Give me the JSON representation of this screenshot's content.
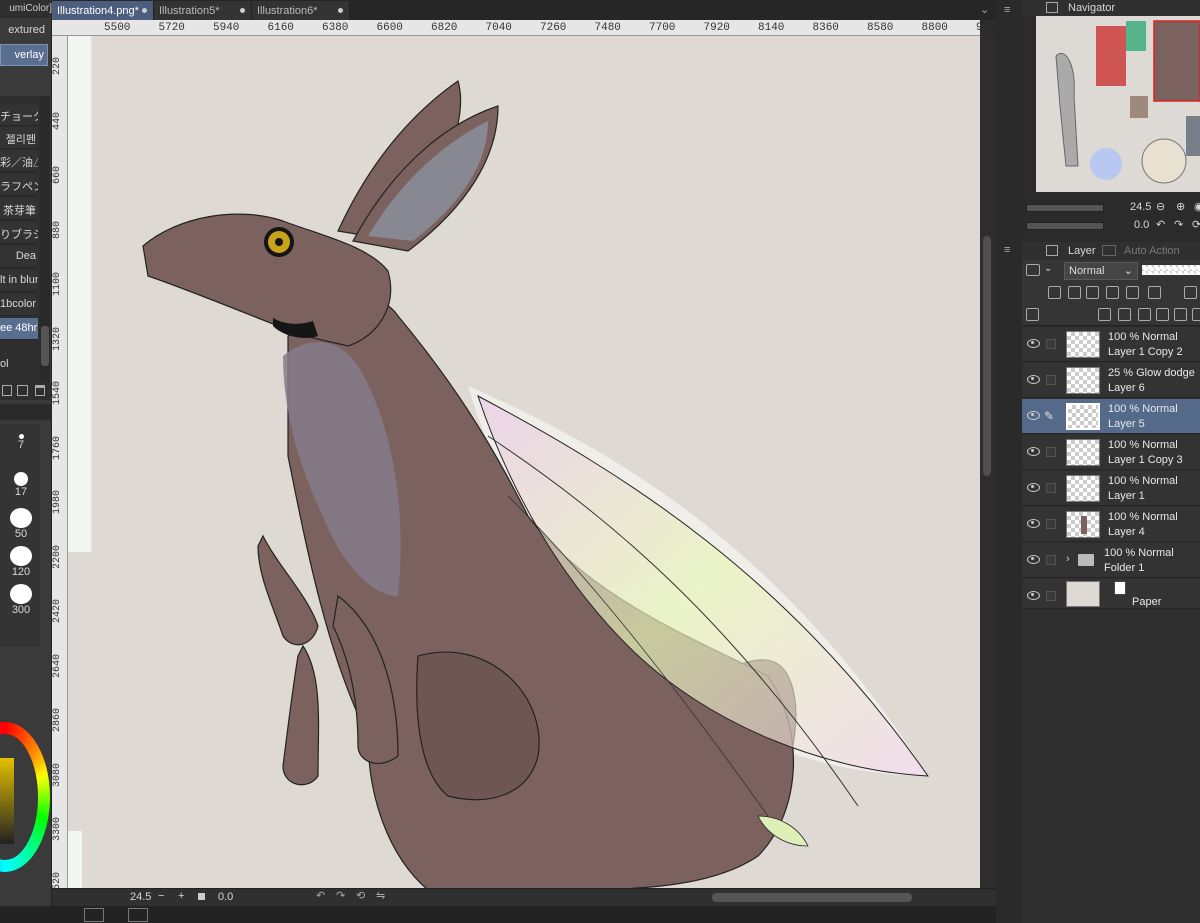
{
  "tabs": [
    {
      "label": "Illustration4.png*",
      "active": true
    },
    {
      "label": "Illustration5*",
      "active": false
    },
    {
      "label": "Illustration6*",
      "active": false
    }
  ],
  "left_panel": {
    "header": "umiColor]",
    "buttons": [
      "extured",
      "verlay"
    ],
    "brush_list": [
      "チョーク",
      "젤리펜",
      "彩／油△",
      "ラフペン",
      "茶芽筆",
      "りブラシ",
      "Dea",
      "lt in blur",
      "1bcolor",
      "ee 48hr)",
      "ol"
    ],
    "brush_sizes": [
      "7",
      "17",
      "50",
      "120",
      "300"
    ]
  },
  "ruler_top": [
    "5500",
    "5720",
    "5940",
    "6160",
    "6380",
    "6600",
    "6820",
    "7040",
    "7260",
    "7480",
    "7700",
    "7920",
    "8140",
    "8360",
    "8580",
    "8800",
    "9020"
  ],
  "ruler_left": [
    "220",
    "440",
    "660",
    "880",
    "1100",
    "1320",
    "1540",
    "1760",
    "1980",
    "2200",
    "2420",
    "2640",
    "2860",
    "3080",
    "3300",
    "3520"
  ],
  "bottom_bar": {
    "zoom": "24.5",
    "rotation": "0.0"
  },
  "navigator": {
    "title": "Navigator",
    "zoom": "24.5",
    "rotation": "0.0"
  },
  "layer_panel": {
    "tab_layer": "Layer",
    "tab_auto_action": "Auto Action",
    "blend_mode": "Normal",
    "layers": [
      {
        "mode": "100 % Normal",
        "name": "Layer 1 Copy 2",
        "selected": false
      },
      {
        "mode": "25 % Glow dodge",
        "name": "Layer 6",
        "selected": false
      },
      {
        "mode": "100 % Normal",
        "name": "Layer 5",
        "selected": true
      },
      {
        "mode": "100 % Normal",
        "name": "Layer 1 Copy 3",
        "selected": false
      },
      {
        "mode": "100 % Normal",
        "name": "Layer 1",
        "selected": false
      },
      {
        "mode": "100 % Normal",
        "name": "Layer 4",
        "selected": false
      },
      {
        "mode": "100 % Normal",
        "name": "Folder 1",
        "selected": false
      },
      {
        "mode": "",
        "name": "Paper",
        "selected": false
      }
    ]
  },
  "colors": {
    "accent": "#556a8a",
    "canvas_bg": "#dedad3",
    "kangaroo": "#7d6662"
  }
}
